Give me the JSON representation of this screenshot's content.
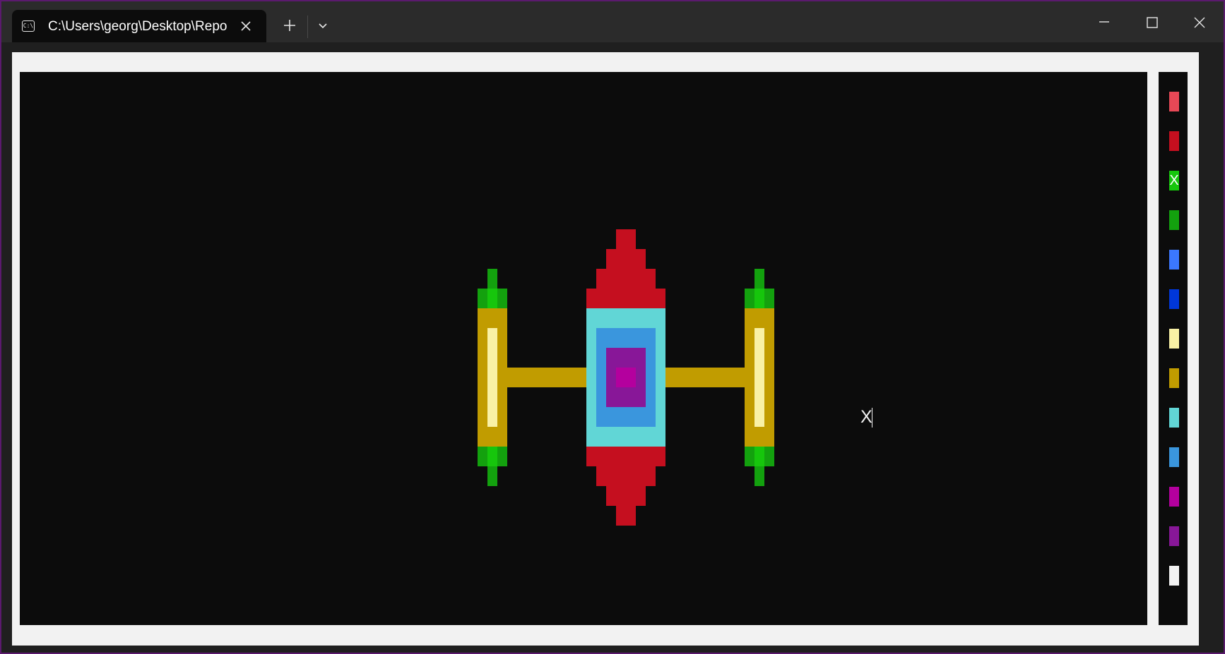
{
  "tab": {
    "title": "C:\\Users\\georg\\Desktop\\Repo",
    "icon": "terminal-icon",
    "close_icon": "close-icon"
  },
  "titlebar": {
    "new_tab_icon": "plus-icon",
    "dropdown_icon": "chevron-down-icon",
    "minimize_icon": "minimize-icon",
    "maximize_icon": "maximize-icon",
    "close_icon": "close-icon"
  },
  "terminal": {
    "cursor_char": "X"
  },
  "palette": {
    "selected_mark": "X",
    "colors": [
      "#e74856",
      "#c50f1f",
      "#16c60c",
      "#13a10e",
      "#3b78ff",
      "#0037da",
      "#f9f1a5",
      "#c19c00",
      "#61d6d6",
      "#3a96dd",
      "#b4009e",
      "#881798",
      "#f2f2f2"
    ],
    "selected_index": 2
  },
  "colors": {
    "background": "#0c0c0c",
    "red": "#c50f1f",
    "green": "#13a10e",
    "bright_green": "#16c60c",
    "yellow": "#c19c00",
    "bright_yellow": "#f9f1a5",
    "cyan": "#61d6d6",
    "blue": "#3a96dd",
    "purple": "#881798",
    "magenta": "#b4009e"
  }
}
